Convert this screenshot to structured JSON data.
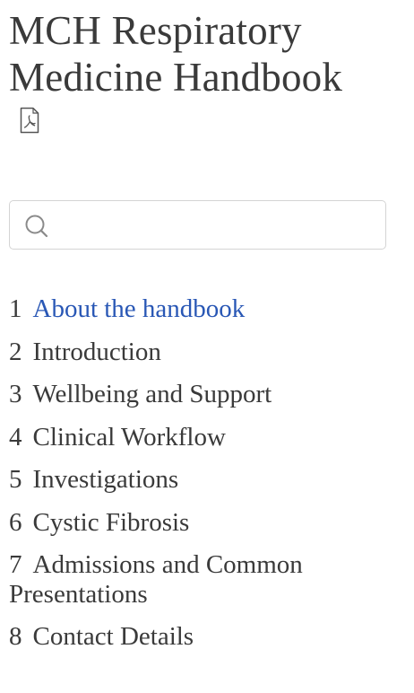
{
  "book": {
    "title": "MCH Respiratory Medicine Handbook",
    "pdf_icon": "pdf-icon"
  },
  "search": {
    "icon": "search-icon",
    "value": "",
    "placeholder": ""
  },
  "toc": {
    "items": [
      {
        "number": "1",
        "label": "About the handbook",
        "active": true
      },
      {
        "number": "2",
        "label": "Introduction",
        "active": false
      },
      {
        "number": "3",
        "label": "Wellbeing and Support",
        "active": false
      },
      {
        "number": "4",
        "label": "Clinical Workflow",
        "active": false
      },
      {
        "number": "5",
        "label": "Investigations",
        "active": false
      },
      {
        "number": "6",
        "label": "Cystic Fibrosis",
        "active": false
      },
      {
        "number": "7",
        "label": "Admissions and Common Presentations",
        "active": false
      },
      {
        "number": "8",
        "label": "Contact Details",
        "active": false
      }
    ]
  },
  "colors": {
    "text": "#3a3a3a",
    "active_link": "#2957b5",
    "border": "#d4d4d4"
  }
}
